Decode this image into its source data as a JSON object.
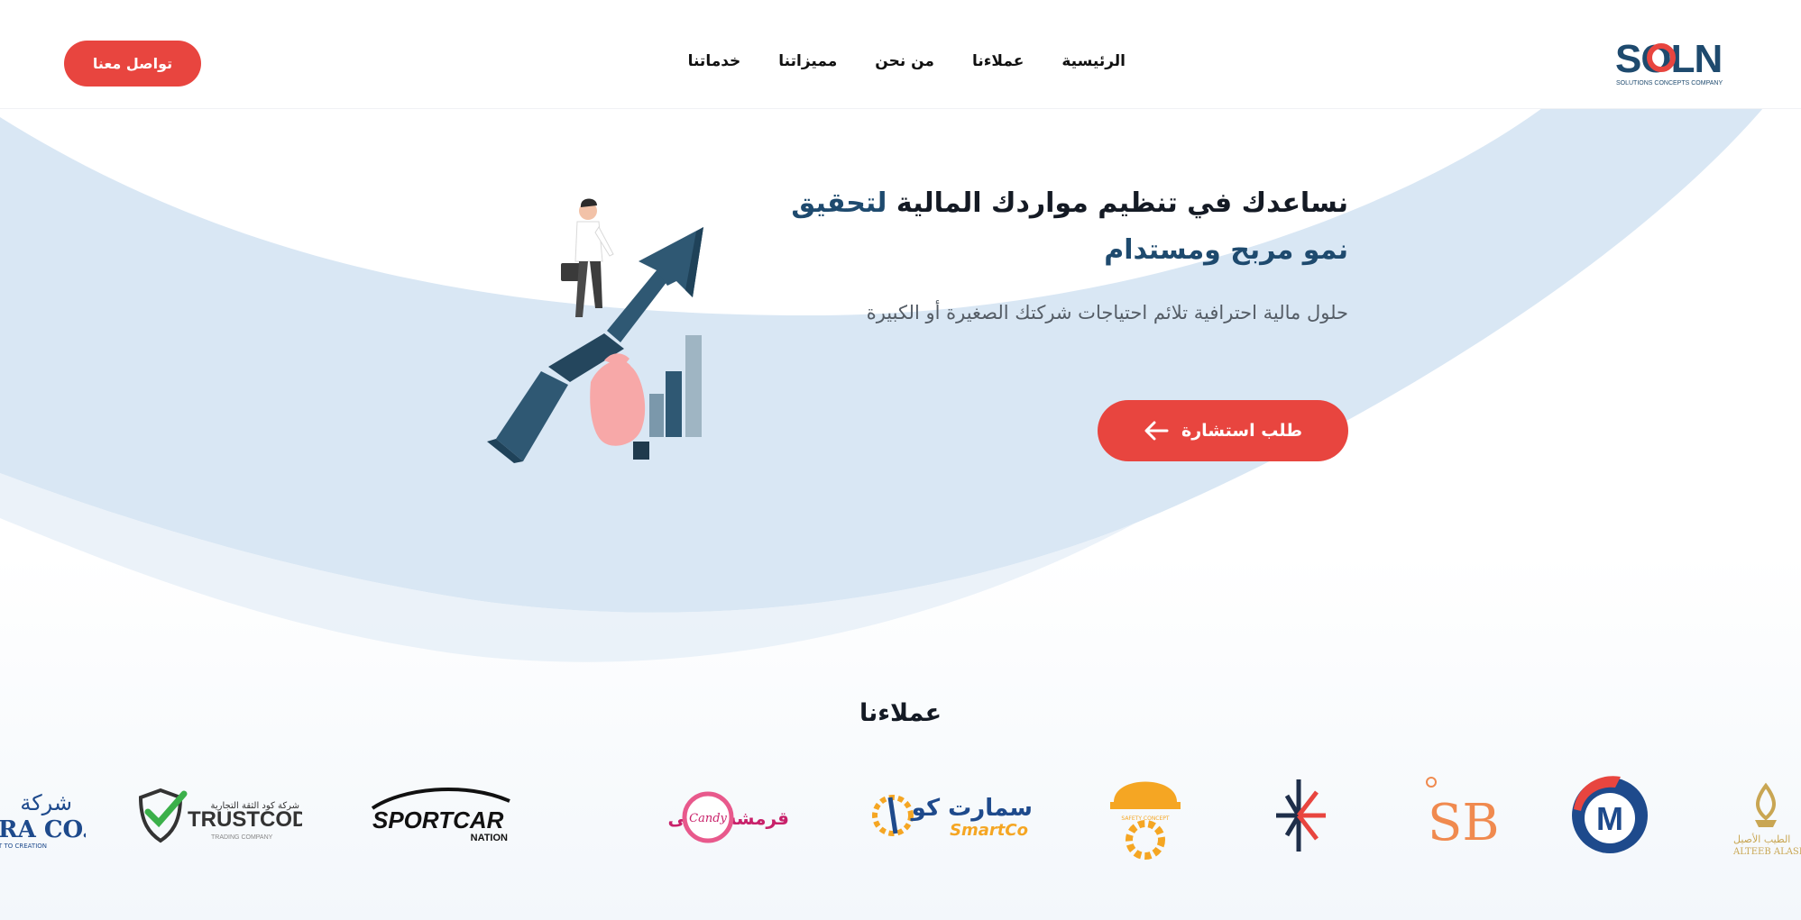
{
  "brand": {
    "logo_text": "SOLN",
    "logo_tagline": "SOLUTIONS CONCEPTS COMPANY",
    "primary_color": "#1e4a6e",
    "accent_color": "#e8453f"
  },
  "nav": {
    "items": [
      "الرئيسية",
      "عملاءنا",
      "من نحن",
      "مميزاتنا",
      "خدماتنا"
    ]
  },
  "header": {
    "contact_label": "تواصل معنا"
  },
  "hero": {
    "headline_part1": "نساعدك في تنظيم مواردك المالية ",
    "headline_accent": "لتحقيق نمو مربح ومستدام",
    "subtext": "حلول مالية احترافية تلائم احتياجات شركتك الصغيرة أو الكبيرة",
    "cta_label": "طلب استشارة",
    "cta_icon": "arrow-left-icon"
  },
  "clients": {
    "title": "عملاءنا",
    "logos": [
      {
        "name": "alteeb",
        "text_ar": "الطيب الأصيل",
        "text_en": "ALTEEB ALASIL"
      },
      {
        "name": "m-circle",
        "text_en": "M"
      },
      {
        "name": "sb",
        "text_en": "SB"
      },
      {
        "name": "snowflake"
      },
      {
        "name": "safety-concept",
        "text_en": "SAFETY CONCEPT"
      },
      {
        "name": "smartco",
        "text_ar": "سمارت كو",
        "text_en": "SmartCo"
      },
      {
        "name": "qarmasha",
        "text_ar": "قرمشة الحلى",
        "text_en": "Candy"
      },
      {
        "name": "sportcar",
        "text_en": "SPORTCAR",
        "text_en2": "NATION"
      },
      {
        "name": "trustcode",
        "text_ar": "شركة كود الثقة التجارية",
        "text_en": "TRUSTCODE",
        "text_en2": "TRADING COMPANY"
      },
      {
        "name": "ra-co",
        "text_ar": "شركة",
        "text_en": "RA CO.",
        "text_en2": "T TO CREATION"
      }
    ]
  }
}
